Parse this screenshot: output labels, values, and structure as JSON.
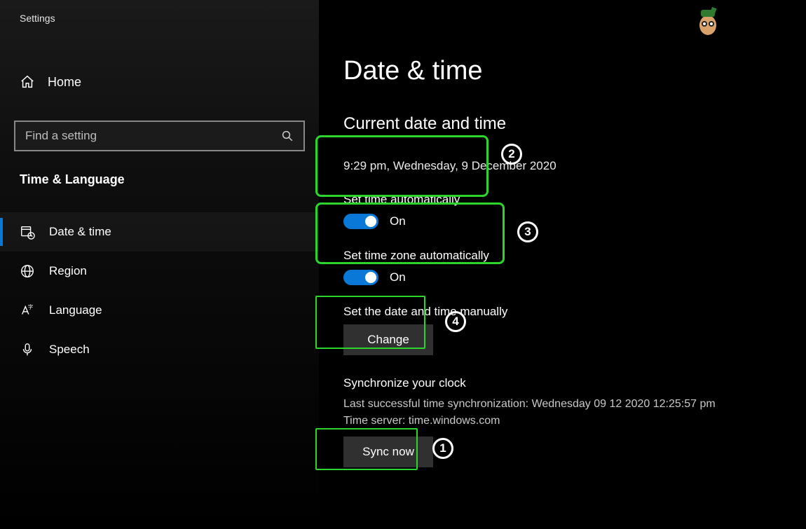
{
  "app_title": "Settings",
  "sidebar": {
    "home_label": "Home",
    "search_placeholder": "Find a setting",
    "category_label": "Time & Language",
    "items": [
      {
        "label": "Date & time"
      },
      {
        "label": "Region"
      },
      {
        "label": "Language"
      },
      {
        "label": "Speech"
      }
    ]
  },
  "page": {
    "title": "Date & time",
    "section_current": "Current date and time",
    "current_datetime": "9:29 pm, Wednesday, 9 December 2020",
    "set_time_auto": {
      "label": "Set time automatically",
      "state": "On"
    },
    "set_tz_auto": {
      "label": "Set time zone automatically",
      "state": "On"
    },
    "manual": {
      "label": "Set the date and time manually",
      "button": "Change"
    },
    "sync": {
      "label": "Synchronize your clock",
      "last_sync": "Last successful time synchronization: Wednesday 09 12 2020 12:25:57 pm",
      "server": "Time server: time.windows.com",
      "button": "Sync now"
    }
  },
  "annotations": {
    "n1": "1",
    "n2": "2",
    "n3": "3",
    "n4": "4"
  }
}
